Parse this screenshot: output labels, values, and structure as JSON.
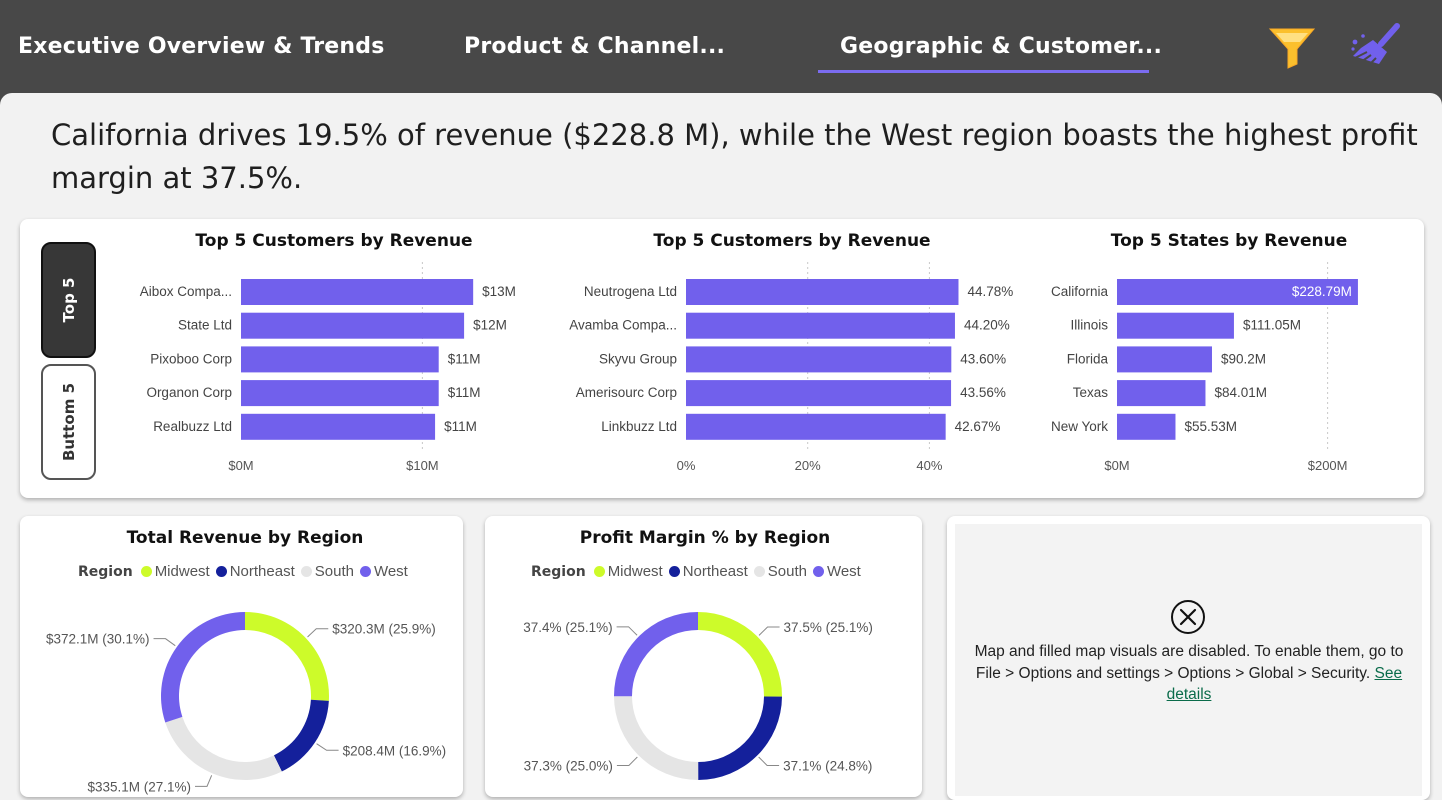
{
  "tabs": [
    {
      "label": "Executive Overview & Trends",
      "active": false
    },
    {
      "label": "Product & Channel...",
      "active": false
    },
    {
      "label": "Geographic & Customer...",
      "active": true
    }
  ],
  "header_icons": [
    "filter-icon",
    "clear-broom-icon"
  ],
  "headline": "California drives 19.5% of revenue ($228.8 M), while the West region boasts the highest profit margin at 37.5%.",
  "toggle": {
    "top_label": "Top 5",
    "bottom_label": "Buttom 5",
    "selected": "Top 5"
  },
  "colors": {
    "bar": "#7160ec",
    "midwest": "#cdfb2a",
    "northeast": "#14209b",
    "south": "#e5e5e5",
    "west": "#7160ec",
    "link": "#0a6b4a"
  },
  "chart_data": [
    {
      "type": "bar",
      "orientation": "horizontal",
      "title": "Top 5 Customers by Revenue",
      "categories": [
        "Aibox Compa...",
        "State Ltd",
        "Pixoboo Corp",
        "Organon Corp",
        "Realbuzz Ltd"
      ],
      "values": [
        12.8,
        12.3,
        10.9,
        10.9,
        10.7
      ],
      "data_labels": [
        "$13M",
        "$12M",
        "$11M",
        "$11M",
        "$11M"
      ],
      "xlim": [
        0,
        14.5
      ],
      "xticks": [
        0,
        10,
        20
      ],
      "xtick_labels": [
        "$0M",
        "$10M",
        ""
      ]
    },
    {
      "type": "bar",
      "orientation": "horizontal",
      "title": "Top 5 Customers by Revenue",
      "categories": [
        "Neutrogena Ltd",
        "Avamba Compa...",
        "Skyvu Group",
        "Amerisourc Corp",
        "Linkbuzz Ltd"
      ],
      "values": [
        44.78,
        44.2,
        43.6,
        43.56,
        42.67
      ],
      "data_labels": [
        "44.78%",
        "44.20%",
        "43.60%",
        "43.56%",
        "42.67%"
      ],
      "xlim": [
        0,
        47
      ],
      "xticks": [
        0,
        20,
        40
      ],
      "xtick_labels": [
        "0%",
        "20%",
        "40%"
      ]
    },
    {
      "type": "bar",
      "orientation": "horizontal",
      "title": "Top 5 States by Revenue",
      "categories": [
        "California",
        "Illinois",
        "Florida",
        "Texas",
        "New York"
      ],
      "values": [
        228.79,
        111.05,
        90.2,
        84.01,
        55.53
      ],
      "data_labels": [
        "$228.79M",
        "$111.05M",
        "$90.2M",
        "$84.01M",
        "$55.53M"
      ],
      "xlim": [
        0,
        245
      ],
      "xticks": [
        0,
        200
      ],
      "xtick_labels": [
        "$0M",
        "$200M"
      ]
    },
    {
      "type": "pie",
      "donut": true,
      "title": "Total Revenue by Region",
      "legend_title": "Region",
      "categories": [
        "Midwest",
        "Northeast",
        "South",
        "West"
      ],
      "values": [
        320.3,
        208.4,
        335.1,
        372.1
      ],
      "data_labels": [
        "$320.3M (25.9%)",
        "$208.4M (16.9%)",
        "$335.1M (27.1%)",
        "$372.1M (30.1%)"
      ]
    },
    {
      "type": "pie",
      "donut": true,
      "title": "Profit Margin % by Region",
      "legend_title": "Region",
      "categories": [
        "Midwest",
        "Northeast",
        "South",
        "West"
      ],
      "values": [
        37.5,
        37.1,
        37.3,
        37.4
      ],
      "data_labels": [
        "37.5% (25.1%)",
        "37.1% (24.8%)",
        "37.3% (25.0%)",
        "37.4% (25.1%)"
      ]
    }
  ],
  "map_notice": {
    "message": "Map and filled map visuals are disabled. To enable them, go to File > Options and settings > Options > Global > Security.",
    "link_text": "See details"
  }
}
